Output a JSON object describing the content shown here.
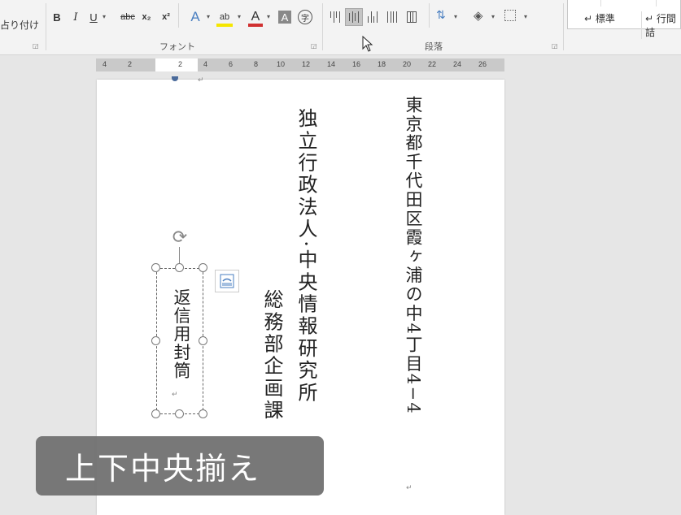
{
  "ribbon": {
    "paste_label": "占り付け",
    "font_group_label": "フォント",
    "paragraph_group_label": "段落",
    "font_buttons": {
      "bold": "B",
      "italic": "I",
      "underline": "U",
      "strikethrough": "abc",
      "subscript": "x₂",
      "superscript": "x²",
      "text_effects": "A",
      "highlight": "ab",
      "font_color": "A",
      "char_shading": "A",
      "enclose": "字"
    },
    "colors": {
      "highlight": "#f5e600",
      "font_color": "#d03030",
      "effects": "#4a7fc1"
    },
    "styles": [
      {
        "label": "↵ 標準"
      },
      {
        "label": "↵ 行間詰"
      }
    ]
  },
  "ruler": {
    "ticks": [
      "4",
      "2",
      "",
      "2",
      "4",
      "6",
      "8",
      "10",
      "12",
      "14",
      "16",
      "18",
      "20",
      "22",
      "24",
      "26"
    ]
  },
  "document": {
    "address": "東京都千代田区霞ヶ浦の中4丁目4−4",
    "organization": "独立行政法人·中央情報研究所",
    "department": "総務部企画課",
    "textbox_text": "返信用封筒",
    "paragraph_mark": "↵"
  },
  "caption": {
    "text": "上下中央揃え"
  }
}
